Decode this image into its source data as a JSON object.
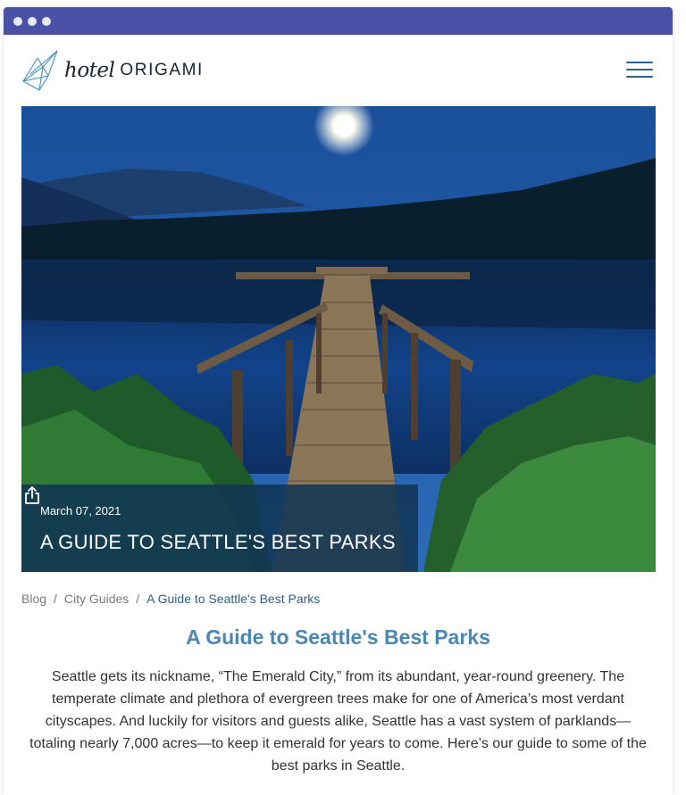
{
  "window": {
    "controls": [
      "dot",
      "dot",
      "dot"
    ]
  },
  "header": {
    "logo_script": "hotel",
    "logo_text": "ORIGAMI",
    "menu_icon": "hamburger-icon"
  },
  "hero": {
    "date": "March 07, 2021",
    "title": "A GUIDE TO SEATTLE'S BEST PARKS",
    "share_icon": "share-icon"
  },
  "breadcrumb": {
    "items": [
      "Blog",
      "City Guides"
    ],
    "separator": "/",
    "current": "A Guide to Seattle's Best Parks"
  },
  "article": {
    "title": "A Guide to Seattle's Best Parks",
    "intro": "Seattle gets its nickname, “The Emerald City,” from its abundant, year-round greenery. The temperate climate and plethora of evergreen trees make for one of America’s most verdant cityscapes. And luckily for visitors and guests alike, Seattle has a vast system of parklands—totaling nearly 7,000 acres—to keep it emerald for years to come. Here’s our guide to some of the best parks in Seattle."
  },
  "colors": {
    "titlebar": "#4a51a6",
    "accent": "#4c86b3",
    "caption_bg": "#103454"
  }
}
